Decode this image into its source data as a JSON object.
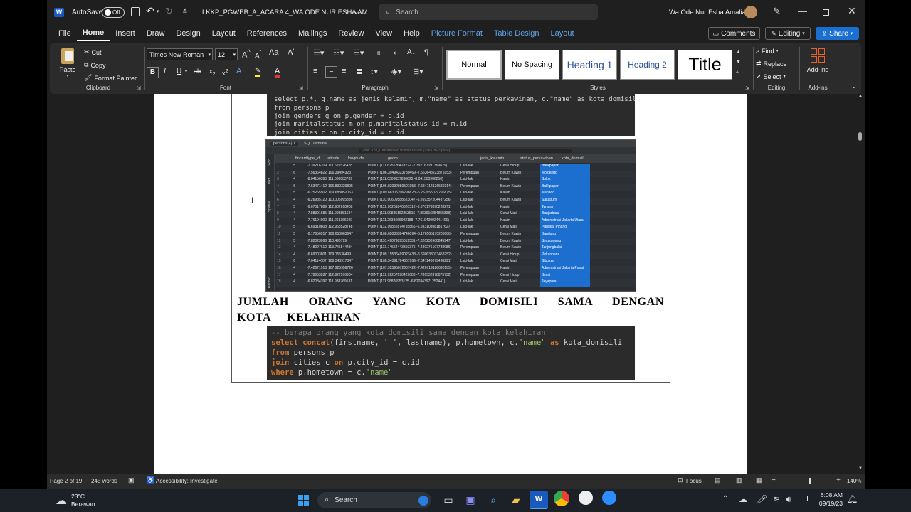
{
  "titlebar": {
    "autosave_label": "AutoSave",
    "autosave_state": "Off",
    "doc_title": "LKKP_PGWEB_A_ACARA 4_WA ODE NUR ESHA AM...",
    "search_placeholder": "Search",
    "user_name": "Wa Ode Nur Esha Amalia"
  },
  "ribbon_tabs": [
    "File",
    "Home",
    "Insert",
    "Draw",
    "Design",
    "Layout",
    "References",
    "Mailings",
    "Review",
    "View",
    "Help",
    "Picture Format",
    "Table Design",
    "Layout"
  ],
  "ribbon_right": {
    "comments": "Comments",
    "editing": "Editing",
    "share": "Share"
  },
  "clipboard": {
    "paste": "Paste",
    "cut": "Cut",
    "copy": "Copy",
    "format_painter": "Format Painter",
    "label": "Clipboard"
  },
  "font": {
    "name": "Times New Roman",
    "size": "12",
    "label": "Font"
  },
  "paragraph": {
    "label": "Paragraph"
  },
  "styles": {
    "items": [
      "Normal",
      "No Spacing",
      "Heading 1",
      "Heading 2",
      "Title"
    ],
    "label": "Styles"
  },
  "editing_grp": {
    "find": "Find",
    "replace": "Replace",
    "select": "Select",
    "label": "Editing"
  },
  "addins": {
    "label": "Add-ins",
    "btn": "Add-ins"
  },
  "code1": {
    "lines": [
      "select p.*, g.name as jenis_kelamin, m.\"name\" as status_perkawinan, c.\"name\" as kota_domisili",
      "from persons p",
      "join genders g on p.gender = g.id",
      "join maritalstatus m on p.maritalstatus_id = m.id",
      "join cities c on p.city_id = c.id"
    ]
  },
  "grid": {
    "tabs": [
      "persons(+) 1",
      "SQL Terminal"
    ],
    "filter_placeholder": "Enter a SQL expression to filter results (use Ctrl+Space)",
    "side_labels": [
      "Grid",
      "Text",
      "Spatial",
      "Record"
    ],
    "columns": [
      "fincardtype_id",
      "latitude",
      "longitude",
      "geom",
      "jenis_kelamin",
      "status_perkawinan",
      "kota_domisili"
    ],
    "rows": [
      [
        "1",
        "5",
        "-7.392167091",
        "111.625526428",
        "POINT (111.625526428222 -7.392167091369629)",
        "Laki-laki",
        "Cerai Hidup",
        "Balikpapan"
      ],
      [
        "2",
        "6",
        "-7.563648224",
        "106.394943237",
        "POINT (106.39494323730469 -7.563648223876953)",
        "Perempuan",
        "Belum Kawin",
        "Mojokerto"
      ],
      [
        "3",
        "4",
        "-8.041503906",
        "111.030883789",
        "POINT (111.0308837890625 -8.041503906250)",
        "Laki-laki",
        "Kawin",
        "Solok"
      ],
      [
        "4",
        "6",
        "-7.634714127",
        "106.830329895",
        "POINT (106.83032989501953 -7.634714126586914)",
        "Perempuan",
        "Belum Kawin",
        "Balikpapan"
      ],
      [
        "5",
        "5",
        "-6.252655029",
        "109.683052063",
        "POINT (109.68305206298828 -6.252655029296875)",
        "Laki-laki",
        "Kawin",
        "Manado"
      ],
      [
        "6",
        "4",
        "-6.269357204",
        "110.006095886",
        "POINT (110.00609588623047 -6.269357204437256)",
        "Laki-laki",
        "Belum Kawin",
        "Sukabumi"
      ],
      [
        "7",
        "5",
        "-6.67017889",
        "112.902618408",
        "POINT (112.90261840820312 -6.670178890228271)",
        "Laki-laki",
        "Kawin",
        "Tarakan"
      ],
      [
        "8",
        "4",
        "-7.883916855",
        "111.908851624",
        "POINT (111.90885162353516 -7.883916854858398)",
        "Laki-laki",
        "Cerai Mati",
        "Banjarbaru"
      ],
      [
        "9",
        "4",
        "-7.761940002",
        "111.263366699",
        "POINT (111.2633666992188 -7.761940002441406)",
        "Laki-laki",
        "Kawin",
        "Administrasi Jakarta Utara"
      ],
      [
        "10",
        "5",
        "-6.693108082",
        "112.968528748",
        "POINT (112.96852874755866 -6.693108081817627)",
        "Laki-laki",
        "Cerai Mati",
        "Pangkal Pinang"
      ],
      [
        "11",
        "5",
        "-6.17656517",
        "108.650863647",
        "POINT (108.65086364746094 -6.176565170288086)",
        "Perempuan",
        "Belum Kawin",
        "Bandung"
      ],
      [
        "12",
        "5",
        "-7.820230961",
        "110.490799",
        "POINT (110.49079895019531 -7.820230960845947)",
        "Laki-laki",
        "Belum Kawin",
        "Singkawang"
      ],
      [
        "13",
        "4",
        "-7.480276108",
        "113.745544434",
        "POINT (113.74554443359375 -7.480276107788086)",
        "Perempuan",
        "Belum Kawin",
        "Tanjungbalai"
      ],
      [
        "14",
        "4",
        "-6.690038013",
        "109.15536499",
        "POINT (109.15536499023438 -6.690038013458252)",
        "Laki-laki",
        "Cerai Hidup",
        "Pekanbaru"
      ],
      [
        "15",
        "6",
        "-7.041140079",
        "108.343917847",
        "POINT (108.34391784667969 -7.041140079498291)",
        "Laki-laki",
        "Cerai Mati",
        "Sibolga"
      ],
      [
        "16",
        "4",
        "-7.426719189",
        "107.925956726",
        "POINT (107.92595672607422 -7.426719188690185)",
        "Perempuan",
        "Kawin",
        "Administrasi Jakarta Pusat"
      ],
      [
        "17",
        "4",
        "-7.786532879",
        "112.922576904",
        "POINT (112.92257690429688 -7.786532878875732)",
        "Perempuan",
        "Cerai Hidup",
        "Binjai"
      ],
      [
        "18",
        "4",
        "-6.820343971",
        "111.988769531",
        "POINT (111.98876953125 -6.820343971252441)",
        "Laki-laki",
        "Cerai Mati",
        "Jayapura"
      ]
    ]
  },
  "heading": "JUMLAH ORANG YANG KOTA DOMISILI SAMA DENGAN KOTA KELAHIRAN",
  "code2": {
    "comment": "-- berapa orang yang kota domisili sama dengan kota kelahiran",
    "l1a": "select",
    "l1b": "concat",
    "l1c": "(firstname, ' ', lastname), p.hometown, c.",
    "l1d": "\"name\"",
    "l1e": " as ",
    "l1f": "kota_domisili",
    "l2a": "from",
    "l2b": " persons p",
    "l3a": "join",
    "l3b": " cities c ",
    "l3c": "on",
    "l3d": " p.city_id = c.id",
    "l4a": "where",
    "l4b": " p.hometown = c.",
    "l4c": "\"name\""
  },
  "statusbar": {
    "page": "Page 2 of 19",
    "words": "245 words",
    "accessibility": "Accessibility: Investigate",
    "focus": "Focus",
    "zoom": "140%"
  },
  "taskbar": {
    "temp": "23°C",
    "weather": "Berawan",
    "search": "Search",
    "time": "6:08 AM",
    "date": "09/19/23"
  }
}
